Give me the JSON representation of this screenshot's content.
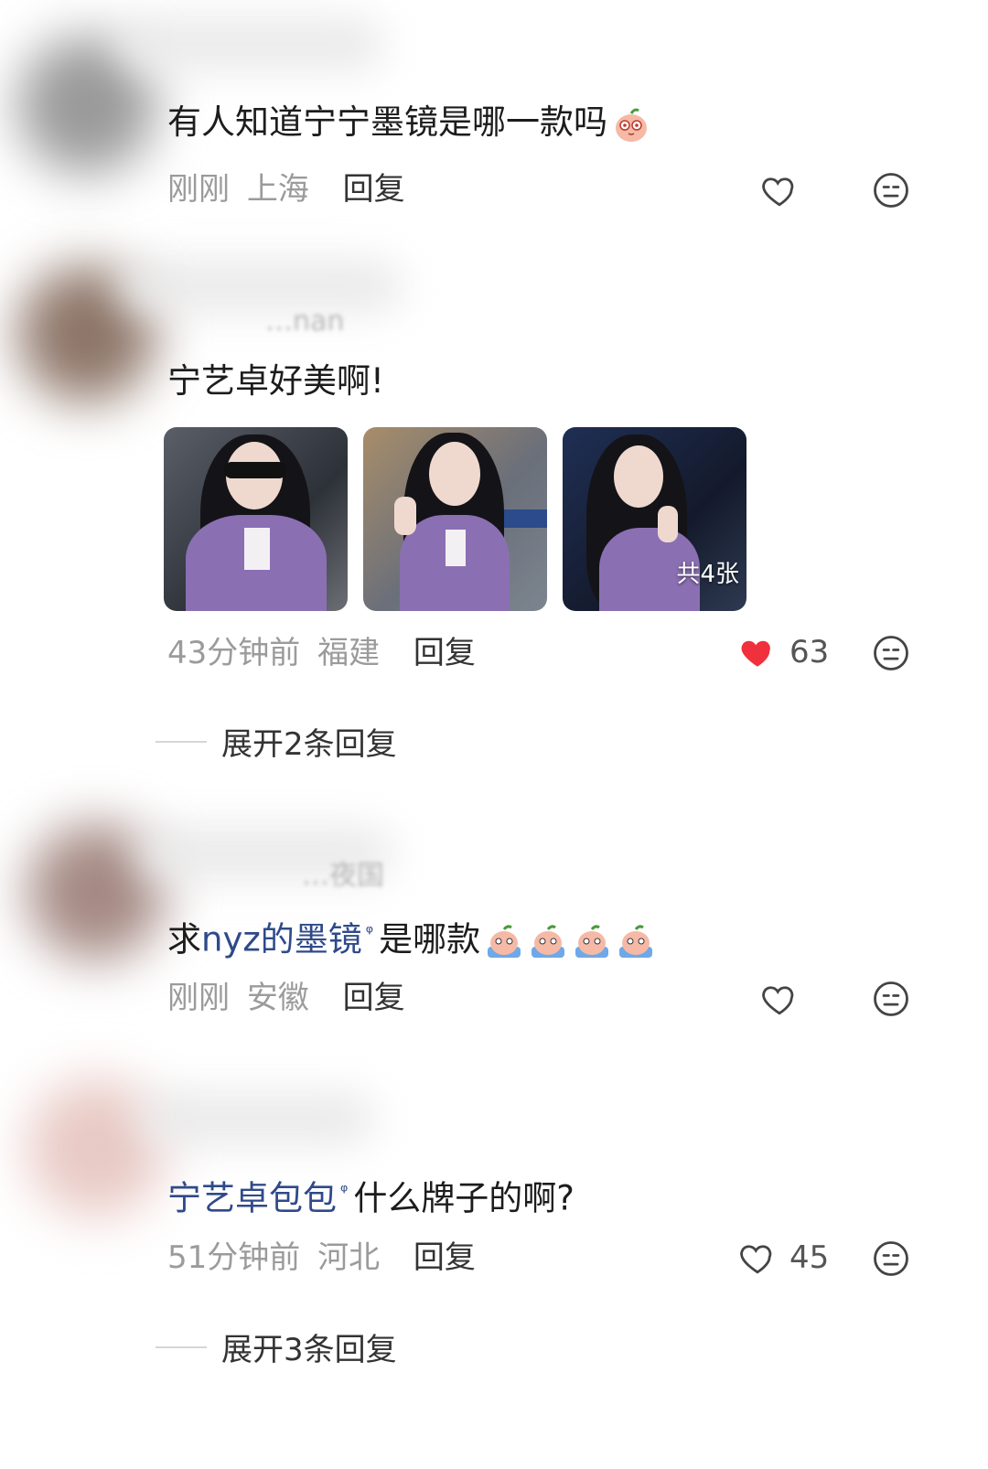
{
  "comments": [
    {
      "text": "有人知道宁宁墨镜是哪一款吗",
      "time": "刚刚",
      "location": "上海",
      "reply": "回复",
      "liked": false
    },
    {
      "name_fragment": "…nan",
      "text": "宁艺卓好美啊!",
      "photo_badge": "共4张",
      "time": "43分钟前",
      "location": "福建",
      "reply": "回复",
      "liked": true,
      "likes": "63",
      "expand": "展开2条回复"
    },
    {
      "name_fragment": "…夜国",
      "text_prefix": "求",
      "text_link": "nyz的墨镜",
      "text_suffix": "是哪款",
      "time": "刚刚",
      "location": "安徽",
      "reply": "回复",
      "liked": false
    },
    {
      "text_link": "宁艺卓包包",
      "text_suffix": "什么牌子的啊?",
      "time": "51分钟前",
      "location": "河北",
      "reply": "回复",
      "liked": false,
      "likes": "45",
      "expand": "展开3条回复"
    }
  ],
  "icons": {
    "heart_outline": "heart-outline-icon",
    "heart_filled": "heart-filled-icon",
    "face": "neutral-face-icon",
    "search": "search-icon",
    "emoji": "peach-emoji"
  },
  "colors": {
    "like_red": "#f0303c",
    "link_blue": "#2f4a8a",
    "meta_gray": "#9b9b9b"
  }
}
